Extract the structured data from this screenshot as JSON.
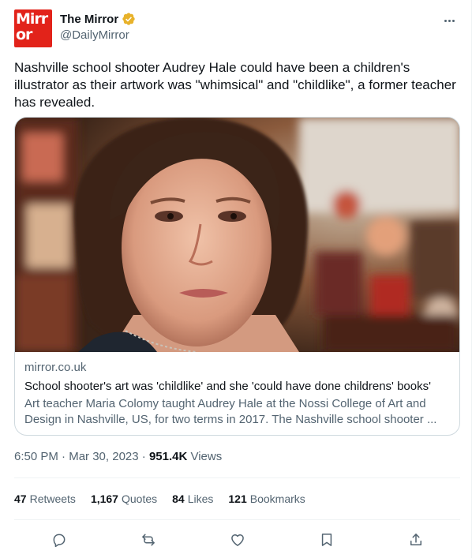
{
  "account": {
    "name": "The Mirror",
    "handle": "@DailyMirror",
    "avatar_text_line1": "Mirr",
    "avatar_text_line2": "or",
    "verified_color": "#e8b22a",
    "brand_color": "#e2231a"
  },
  "tweet": {
    "text": "Nashville school shooter Audrey Hale could have been a children's illustrator as their artwork was \"whimsical\" and \"childlike\", a former teacher has revealed."
  },
  "card": {
    "domain": "mirror.co.uk",
    "title": "School shooter's art was 'childlike' and she 'could have done childrens' books'",
    "description": "Art teacher Maria Colomy taught Audrey Hale at the Nossi College of Art and Design in Nashville, US, for two terms in 2017. The Nashville school shooter ..."
  },
  "meta": {
    "time": "6:50 PM",
    "separator1": " · ",
    "date": "Mar 30, 2023",
    "separator2": " · ",
    "views_count": "951.4K",
    "views_label": " Views"
  },
  "stats": {
    "retweets_count": "47",
    "retweets_label": "Retweets",
    "quotes_count": "1,167",
    "quotes_label": "Quotes",
    "likes_count": "84",
    "likes_label": "Likes",
    "bookmarks_count": "121",
    "bookmarks_label": "Bookmarks"
  },
  "actions": {
    "icons": [
      "reply-icon",
      "retweet-icon",
      "like-icon",
      "bookmark-icon",
      "share-icon"
    ],
    "icon_color": "#536471"
  }
}
